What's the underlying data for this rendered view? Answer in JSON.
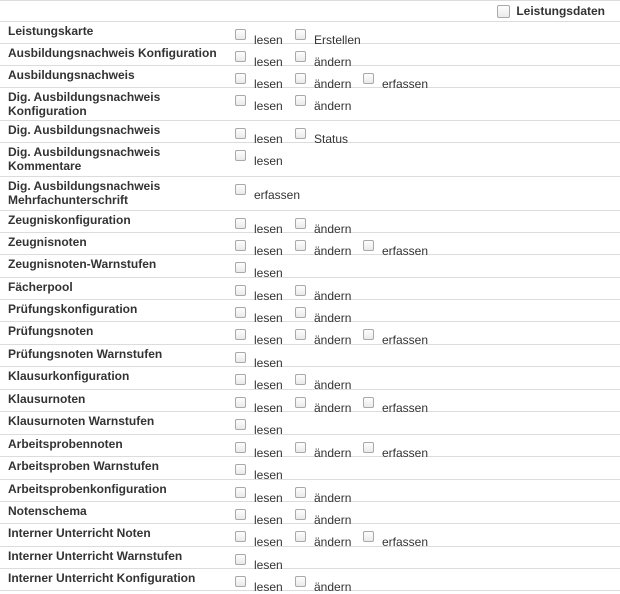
{
  "header": {
    "label": "Leistungsdaten",
    "checked": false
  },
  "rows": [
    {
      "label": "Leistungskarte",
      "perms": [
        "lesen",
        "Erstellen"
      ]
    },
    {
      "label": "Ausbildungsnachweis Konfiguration",
      "perms": [
        "lesen",
        "ändern"
      ]
    },
    {
      "label": "Ausbildungsnachweis",
      "perms": [
        "lesen",
        "ändern",
        "erfassen"
      ]
    },
    {
      "label": "Dig. Ausbildungsnachweis Konfiguration",
      "perms": [
        "lesen",
        "ändern"
      ]
    },
    {
      "label": "Dig. Ausbildungsnachweis",
      "perms": [
        "lesen",
        "Status"
      ]
    },
    {
      "label": "Dig. Ausbildungsnachweis Kommentare",
      "perms": [
        "lesen"
      ]
    },
    {
      "label": "Dig. Ausbildungsnachweis Mehrfachunterschrift",
      "perms": [
        "erfassen"
      ]
    },
    {
      "label": "Zeugniskonfiguration",
      "perms": [
        "lesen",
        "ändern"
      ]
    },
    {
      "label": "Zeugnisnoten",
      "perms": [
        "lesen",
        "ändern",
        "erfassen"
      ]
    },
    {
      "label": "Zeugnisnoten-Warnstufen",
      "perms": [
        "lesen"
      ]
    },
    {
      "label": "Fächerpool",
      "perms": [
        "lesen",
        "ändern"
      ]
    },
    {
      "label": "Prüfungskonfiguration",
      "perms": [
        "lesen",
        "ändern"
      ]
    },
    {
      "label": "Prüfungsnoten",
      "perms": [
        "lesen",
        "ändern",
        "erfassen"
      ]
    },
    {
      "label": "Prüfungsnoten Warnstufen",
      "perms": [
        "lesen"
      ]
    },
    {
      "label": "Klausurkonfiguration",
      "perms": [
        "lesen",
        "ändern"
      ]
    },
    {
      "label": "Klausurnoten",
      "perms": [
        "lesen",
        "ändern",
        "erfassen"
      ]
    },
    {
      "label": "Klausurnoten Warnstufen",
      "perms": [
        "lesen"
      ]
    },
    {
      "label": "Arbeitsprobennoten",
      "perms": [
        "lesen",
        "ändern",
        "erfassen"
      ]
    },
    {
      "label": "Arbeitsproben Warnstufen",
      "perms": [
        "lesen"
      ]
    },
    {
      "label": "Arbeitsprobenkonfiguration",
      "perms": [
        "lesen",
        "ändern"
      ]
    },
    {
      "label": "Notenschema",
      "perms": [
        "lesen",
        "ändern"
      ]
    },
    {
      "label": "Interner Unterricht Noten",
      "perms": [
        "lesen",
        "ändern",
        "erfassen"
      ]
    },
    {
      "label": "Interner Unterricht Warnstufen",
      "perms": [
        "lesen"
      ]
    },
    {
      "label": "Interner Unterricht Konfiguration",
      "perms": [
        "lesen",
        "ändern"
      ]
    }
  ]
}
